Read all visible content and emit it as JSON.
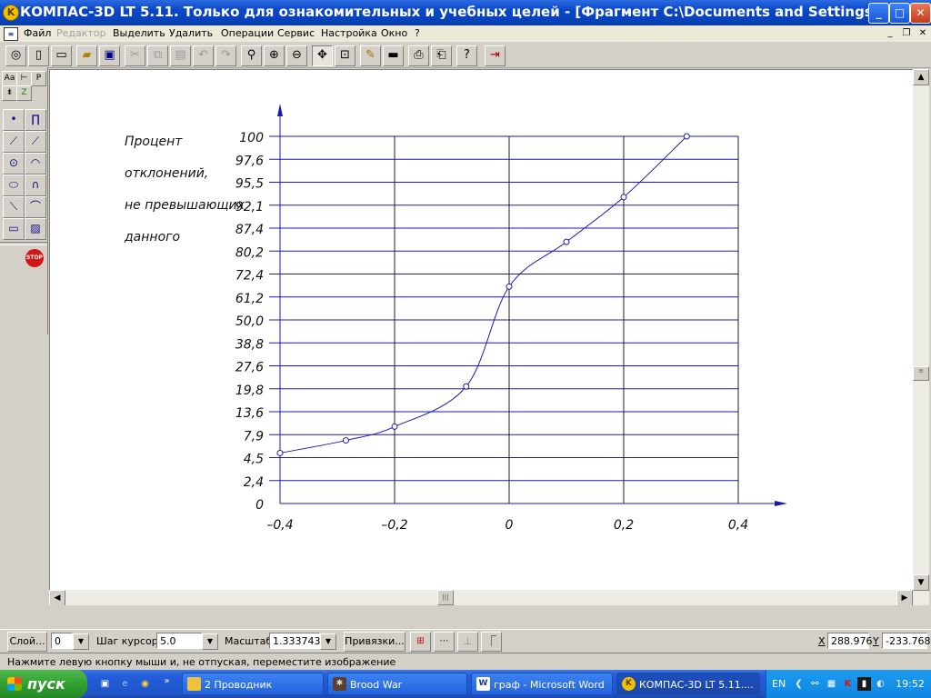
{
  "titlebar": {
    "title": "КОМПАС-3D LT 5.11. Только для ознакомительных и учебных целей - [Фрагмент C:\\Documents and Settings\\оем\\Мо...",
    "app_icon": "kompas-icon",
    "buttons": [
      "minimize",
      "maximize",
      "close"
    ]
  },
  "menubar": {
    "items": [
      {
        "label": "Файл",
        "enabled": true
      },
      {
        "label": "Редактор",
        "enabled": false
      },
      {
        "label": "Выделить",
        "enabled": true
      },
      {
        "label": "Удалить",
        "enabled": true
      },
      {
        "label": "Операции",
        "enabled": true
      },
      {
        "label": "Сервис",
        "enabled": true
      },
      {
        "label": "Настройка",
        "enabled": true
      },
      {
        "label": "Окно",
        "enabled": true
      },
      {
        "label": "?",
        "enabled": true
      }
    ]
  },
  "toolbar": {
    "buttons": [
      "compass-icon",
      "new-doc-icon",
      "new-sheet-icon",
      "open-icon",
      "save-icon",
      "cut-icon",
      "copy-icon",
      "paste-icon",
      "undo-icon",
      "redo-icon",
      "zoom-icon",
      "zoom-in-icon",
      "zoom-out-icon",
      "pan-icon",
      "zoom-fit-icon",
      "regenerate-icon",
      "display-icon",
      "print-preview-icon",
      "print-icon",
      "help-icon",
      "exit-icon"
    ]
  },
  "chart_data": {
    "type": "line",
    "side_label": [
      "Процент",
      "отклонений,",
      "не превышающих",
      "данного"
    ],
    "x_ticks": [
      "–0,4",
      "–0,2",
      "0",
      "0,2",
      "0,4"
    ],
    "x_tick_values": [
      -0.4,
      -0.2,
      0,
      0.2,
      0.4
    ],
    "y_ticks": [
      "0",
      "2,4",
      "4,5",
      "7,9",
      "13,6",
      "19,8",
      "27,6",
      "38,8",
      "50,0",
      "61,2",
      "72,4",
      "80,2",
      "87,4",
      "92,1",
      "95,5",
      "97,6",
      "100"
    ],
    "points": [
      {
        "x": -0.4,
        "y_rank": 2.2
      },
      {
        "x": -0.285,
        "y_rank": 2.75
      },
      {
        "x": -0.2,
        "y_rank": 3.35
      },
      {
        "x": -0.075,
        "y_rank": 5.1
      },
      {
        "x": 0.0,
        "y_rank": 9.45
      },
      {
        "x": 0.1,
        "y_rank": 11.4
      },
      {
        "x": 0.2,
        "y_rank": 13.35
      },
      {
        "x": 0.31,
        "y_rank": 16
      }
    ],
    "xlim": [
      -0.4,
      0.4
    ],
    "grid": true,
    "color": "#1a1ab4"
  },
  "bottombar": {
    "layer_button": "Слой...",
    "layer_value": "0",
    "step_label": "Шаг курсора",
    "step_value": "5.0",
    "scale_label": "Масштаб",
    "scale_value": "1.333743",
    "snaps_button": "Привязки...",
    "x_label": "X",
    "x_value": "288.976",
    "y_label": "Y",
    "y_value": "-233.768"
  },
  "statusbar": {
    "text": "Нажмите левую кнопку мыши и, не отпуская, переместите изображение"
  },
  "taskbar": {
    "start": "пуск",
    "tasks": [
      {
        "label": "2 Проводник",
        "icon": "folder-icon"
      },
      {
        "label": "Brood War",
        "icon": "game-icon"
      },
      {
        "label": "граф - Microsoft Word",
        "icon": "word-icon"
      },
      {
        "label": "КОМПАС-3D LT 5.11....",
        "icon": "kompas-icon"
      }
    ],
    "lang": "EN",
    "time": "19:52"
  }
}
